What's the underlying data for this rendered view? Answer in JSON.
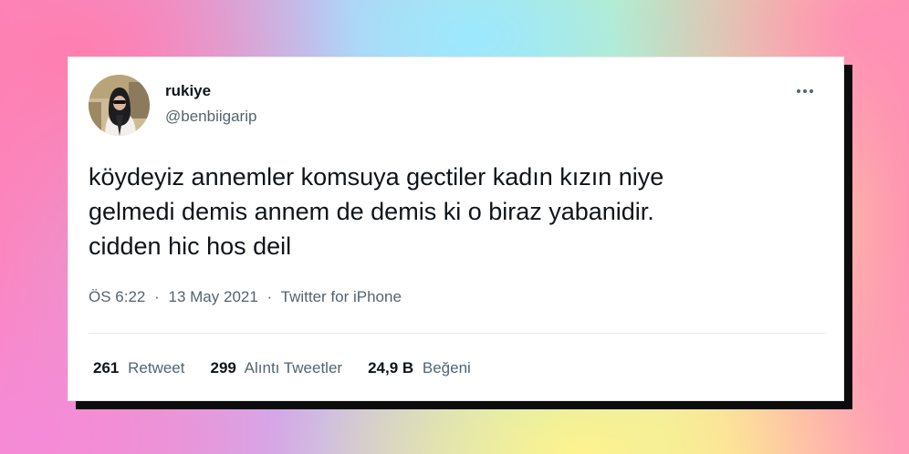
{
  "tweet": {
    "author": {
      "name": "rukiye",
      "handle": "@benbiigarip"
    },
    "more_icon": "more-horizontal-icon",
    "text_lines": [
      "köydeyiz annemler komsuya gectiler kadın kızın niye",
      "gelmedi demis annem de demis ki o biraz yabanidir.",
      "cidden hic hos deil"
    ],
    "time": "ÖS 6:22",
    "date": "13 May 2021",
    "separator": "·",
    "source": "Twitter for iPhone",
    "stats": [
      {
        "count": "261",
        "label": "Retweet"
      },
      {
        "count": "299",
        "label": "Alıntı Tweetler"
      },
      {
        "count": "24,9 B",
        "label": "Beğeni"
      }
    ]
  },
  "colors": {
    "text_primary": "#0f1419",
    "text_secondary": "#536471",
    "card_background": "#ffffff",
    "card_shadow": "#0c0c0c"
  }
}
